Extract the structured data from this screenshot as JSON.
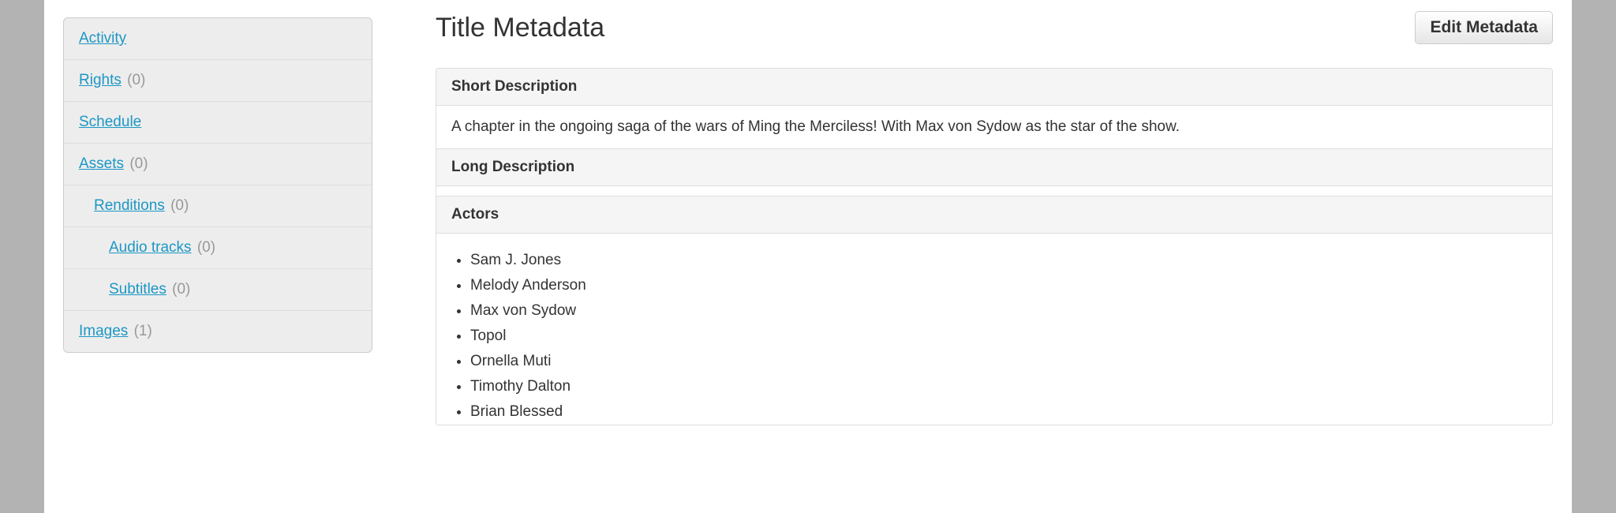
{
  "sidebar": {
    "items": [
      {
        "label": "Activity",
        "count": null,
        "indent": 0
      },
      {
        "label": "Rights",
        "count": "(0)",
        "indent": 0
      },
      {
        "label": "Schedule",
        "count": null,
        "indent": 0
      },
      {
        "label": "Assets",
        "count": "(0)",
        "indent": 0
      },
      {
        "label": "Renditions",
        "count": "(0)",
        "indent": 1
      },
      {
        "label": "Audio tracks",
        "count": "(0)",
        "indent": 2
      },
      {
        "label": "Subtitles",
        "count": "(0)",
        "indent": 2
      },
      {
        "label": "Images",
        "count": "(1)",
        "indent": 0
      }
    ]
  },
  "main": {
    "title": "Title Metadata",
    "editButton": "Edit Metadata",
    "sections": {
      "shortDescription": {
        "heading": "Short Description",
        "body": "A chapter in the ongoing saga of the wars of Ming the Merciless! With Max von Sydow as the star of the show."
      },
      "longDescription": {
        "heading": "Long Description",
        "body": ""
      },
      "actors": {
        "heading": "Actors",
        "list": [
          "Sam J. Jones",
          "Melody Anderson",
          "Max von Sydow",
          "Topol",
          "Ornella Muti",
          "Timothy Dalton",
          "Brian Blessed"
        ]
      }
    }
  }
}
